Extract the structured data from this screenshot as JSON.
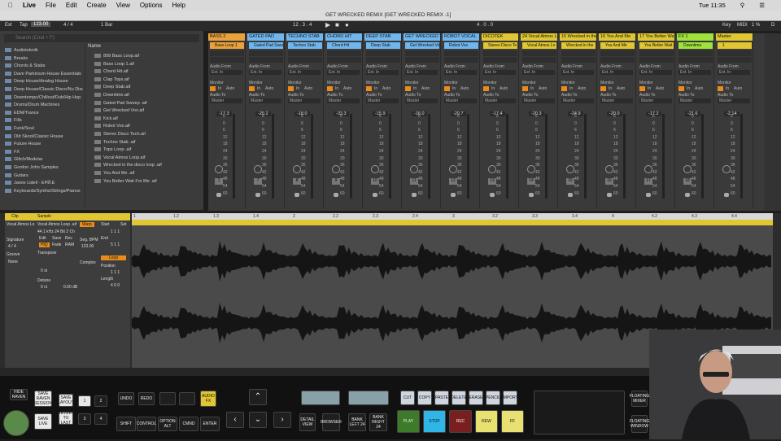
{
  "menubar": {
    "apple": "",
    "app": "Live",
    "items": [
      "File",
      "Edit",
      "Create",
      "View",
      "Options",
      "Help"
    ],
    "right": "Tue 11:35"
  },
  "toolbar": {
    "ext": "Ext",
    "tap": "Tap",
    "tempo": "123.00",
    "sig": "4 / 4",
    "bar": "1 Bar",
    "pos": "12 . 3 . 4",
    "end": "4 . 0 . 0",
    "title": "GET WRECKED REMIX  [GET WRECKED REMIX -1]",
    "key": "Key",
    "midi": "MIDI",
    "cpu": "1 %",
    "d": "D"
  },
  "browser": {
    "search_placeholder": "Search (Cmd + F)",
    "name_header": "Name",
    "categories": [
      "Audiotekniik",
      "Breaks",
      "Chords & Stabs",
      "Dave Parkinson House Essentials",
      "Deep House/Analog House",
      "Deep House/Classic Disco/Nu Disco",
      "Downtempo/Chillout/Dub/Hip Hop",
      "Drums/Drum Machines",
      "EDM/Trance",
      "Fills",
      "Funk/Soul",
      "Old Skool/Classic House",
      "Future House",
      "FX",
      "Glitch/Modular",
      "Gordon John Samples",
      "Guitars",
      "Jamie Lidell - ЕРЙ.Е",
      "Keyboards/Synths/Strings/Pianos"
    ],
    "files": [
      "808 Bass Loop.aif",
      "Bass Loop 1.aif",
      "Chord Hit.aif",
      "Clap Tops.aif",
      "Deep Stab.aif",
      "Downtime.aif",
      "Gated Pad Sweep .aif",
      "Get Wrecked Vox.aif",
      "Kick.aif",
      "Robot Vox.aif",
      "Stereo Disco Tech.aif",
      "Techno Stab .aif",
      "Tops Loop .aif",
      "Vocal Atmos Loop.aif",
      "Wrecked in the disco loop .aif",
      "You And Me .aif",
      "You Better Wait For Me .aif"
    ]
  },
  "tracks": [
    {
      "name": "BASS 2",
      "color": "#e9a23b",
      "clip": "Bass Loop 1",
      "vol": "-17.3",
      "num": "1"
    },
    {
      "name": "GATED PAD",
      "color": "#6fb6ee",
      "clip": "Gated Pad Sweep",
      "vol": "-20.2",
      "num": "7"
    },
    {
      "name": "TECHNO STAB",
      "color": "#6fb6ee",
      "clip": "Techno Stab",
      "vol": "-18.0",
      "num": "8"
    },
    {
      "name": "CHORD HIT",
      "color": "#6fb6ee",
      "clip": "Chord Hit",
      "vol": "-33.3",
      "num": "9"
    },
    {
      "name": "DEEP STAB",
      "color": "#6fb6ee",
      "clip": "Deep Stab",
      "vol": "-15.9",
      "num": "10"
    },
    {
      "name": "GET WRECKED VO",
      "color": "#6fb6ee",
      "clip": "Get Wrecked Vo",
      "vol": "-16.0",
      "num": "11"
    },
    {
      "name": "ROBOT VOCAL",
      "color": "#6fb6ee",
      "clip": "Robot Vox",
      "vol": "-20.7",
      "num": "12"
    },
    {
      "name": "DICOTEK",
      "color": "#e0c632",
      "clip": "Stereo Disco Te",
      "vol": "-17.4",
      "num": "13"
    },
    {
      "name": "24 Vocal Atmos Lo",
      "color": "#e0c632",
      "clip": "Vocal Atmos Lo",
      "vol": "-20.3",
      "num": "14"
    },
    {
      "name": "15 Wrecked in the",
      "color": "#e0c632",
      "clip": "Wrecked in the",
      "vol": "-24.9",
      "num": "15"
    },
    {
      "name": "16 You And Me",
      "color": "#e0c632",
      "clip": "You And Me",
      "vol": "-20.0",
      "num": "16"
    },
    {
      "name": "17 You Better Wait",
      "color": "#e0c632",
      "clip": "You Better Wait",
      "vol": "-17.2",
      "num": "17"
    },
    {
      "name": "FX 1",
      "color": "#9ee23b",
      "clip": "Downtime",
      "vol": "-21.6",
      "num": "18"
    },
    {
      "name": "Master",
      "color": "#e0c632",
      "clip": "1",
      "vol": "-2.14",
      "num": ""
    }
  ],
  "mixer_labels": {
    "audio_from": "Audio From",
    "ext_in": "Ext. In",
    "monitor": "Monitor",
    "in": "In",
    "auto": "Auto",
    "off": "Off",
    "audio_to": "Audio To",
    "master": "Master",
    "cue_out": "Cue Out",
    "master_out": "Master Out",
    "half": "1/2",
    "scale": [
      "6",
      "0",
      "6",
      "12",
      "18",
      "24",
      "30",
      "36",
      "42",
      "48",
      "54",
      "60"
    ]
  },
  "clip": {
    "tab_clip": "Clip",
    "tab_sample": "Sample",
    "name": "Vocal Atmos Lo",
    "file": "Vocal Atmos Loop .aif",
    "info": "44.1 kHz 24 Bit 2 Ch",
    "edit": "Edit",
    "save": "Save",
    "rev": "Rev",
    "hiq": "HiQ",
    "fade": "Fade",
    "ram": "RAM",
    "warp": "Warp",
    "start": "Start",
    "set": "Set",
    "end": "End",
    "seg_bpm": "Seg. BPM",
    "bpm": "123.00",
    "signature": "Signature",
    "sig": "4 / 4",
    "groove": "Groove",
    "none": "None",
    "transpose": "Transpose",
    "st": "0 st",
    "detune": "Detune",
    "ct": "0 ct",
    "db": "0.00 dB",
    "complex": "Complex",
    "loop": "Loop",
    "position": "Position",
    "length": "Length",
    "start_val": "1  1  1",
    "end_val": "5  1  1",
    "pos_val": "1  1  1",
    "len_val": "4  0  0"
  },
  "ruler": [
    "1",
    "1.2",
    "1.3",
    "1.4",
    "2",
    "2.2",
    "2.3",
    "2.4",
    "3",
    "3.2",
    "3.3",
    "3.4",
    "4",
    "4.2",
    "4.3",
    "4.4"
  ],
  "controller": {
    "hide_raven": "HIDE RAVEN",
    "save_raven": "SAVE RAVEN SESSION",
    "save_layout": "SAVE LAYOUT",
    "revert": "REVERT TO LAST",
    "save_live": "SAVE LIVE",
    "undo": "UNDO",
    "redo": "REDO",
    "audio_fx": "AUDIO FX",
    "shift": "SHIFT",
    "control": "CONTROL",
    "option": "OPTION ALT",
    "cmd": "CMND",
    "enter": "ENTER",
    "detail": "DETAIL VIEW",
    "browser": "BROWSER",
    "bank_l": "BANK LEFT 24",
    "bank_r": "BANK RIGHT 24",
    "play": "PLAY",
    "stop": "STOP",
    "rec": "REC",
    "rew": "REW",
    "ff": "FF",
    "fmix": "FLOATING MIXER",
    "fwin": "FLOATING WINDOW",
    "hide": "HIDE",
    "n1": "1",
    "n2": "2",
    "n3": "3",
    "n4": "4",
    "tools": [
      "CUT",
      "COPY",
      "PASTE",
      "DELETE",
      "ERASE",
      "PENCIL",
      "IMPORT"
    ]
  }
}
